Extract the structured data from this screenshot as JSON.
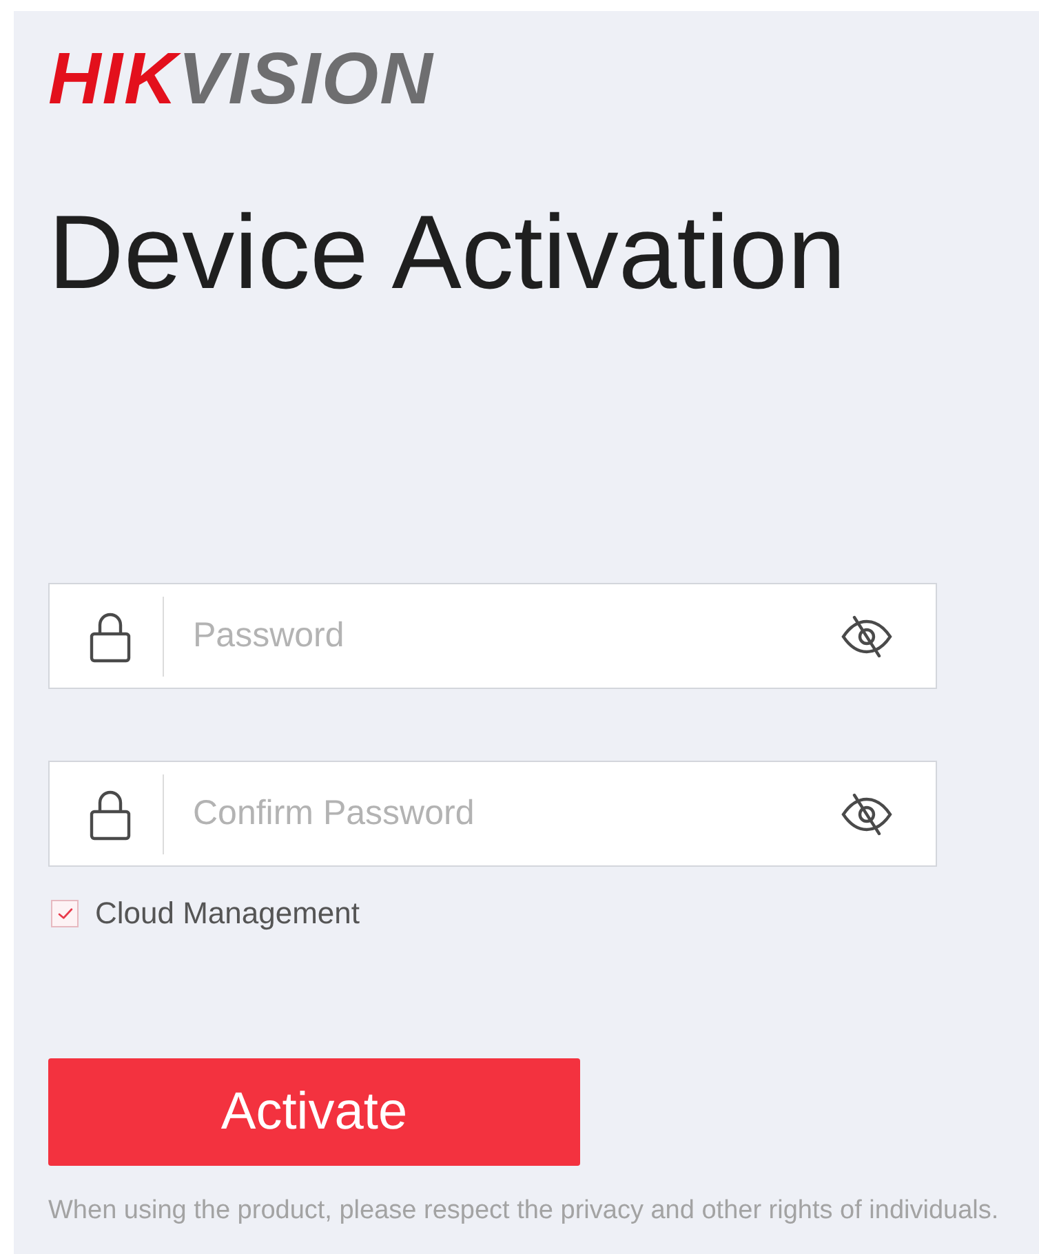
{
  "logo": {
    "red_text": "HIK",
    "grey_text": "VISION"
  },
  "title": "Device Activation",
  "fields": [
    {
      "placeholder": "Password",
      "revealed": false
    },
    {
      "placeholder": "Confirm Password",
      "revealed": false
    }
  ],
  "cloud_management": {
    "label": "Cloud Management",
    "checked": true
  },
  "button": {
    "label": "Activate"
  },
  "notice": "When using the product, please respect the privacy and other rights of individuals."
}
